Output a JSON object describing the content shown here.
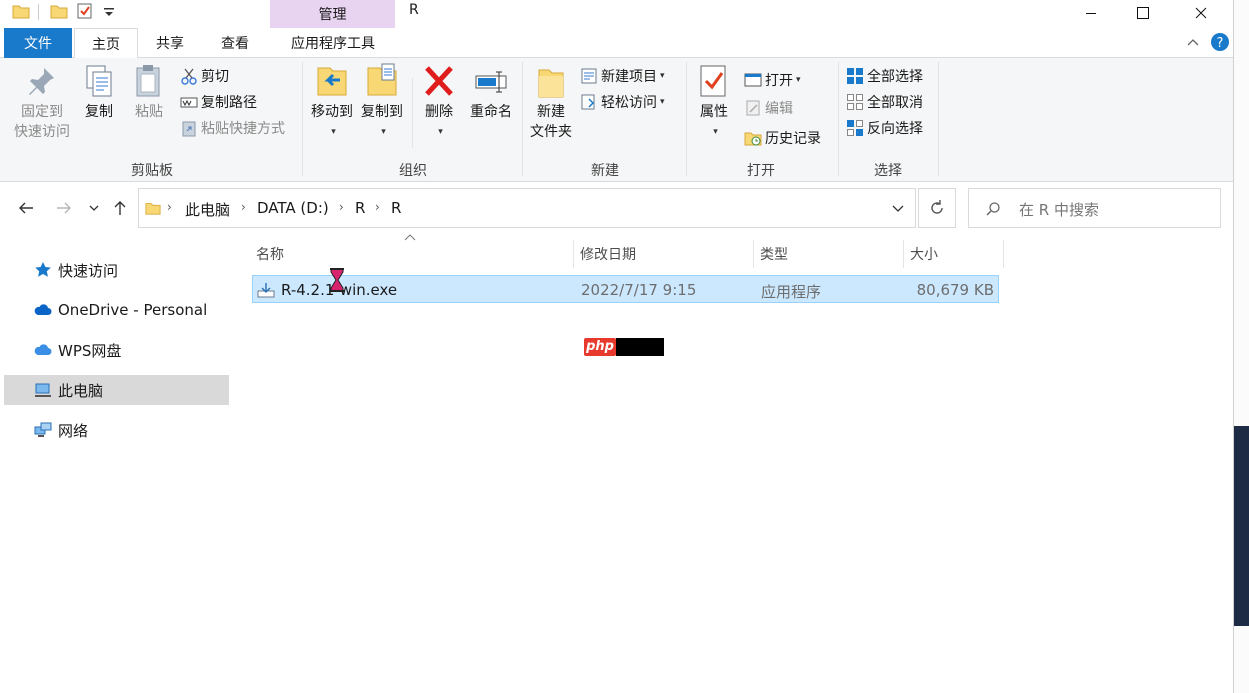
{
  "window": {
    "title": "R",
    "context_tab_group": "管理"
  },
  "tabs": [
    {
      "label": "文件"
    },
    {
      "label": "主页"
    },
    {
      "label": "共享"
    },
    {
      "label": "查看"
    },
    {
      "label": "应用程序工具"
    }
  ],
  "ribbon": {
    "clipboard": {
      "group_label": "剪贴板",
      "pin_line1": "固定到",
      "pin_line2": "快速访问",
      "copy": "复制",
      "paste": "粘贴",
      "cut": "剪切",
      "copy_path": "复制路径",
      "paste_shortcut": "粘贴快捷方式"
    },
    "organize": {
      "group_label": "组织",
      "move_to": "移动到",
      "copy_to": "复制到",
      "delete": "删除",
      "rename": "重命名"
    },
    "new": {
      "group_label": "新建",
      "new_folder_line1": "新建",
      "new_folder_line2": "文件夹",
      "new_item": "新建项目",
      "easy_access": "轻松访问"
    },
    "open": {
      "group_label": "打开",
      "properties": "属性",
      "open": "打开",
      "edit": "编辑",
      "history": "历史记录"
    },
    "select": {
      "group_label": "选择",
      "select_all": "全部选择",
      "select_none": "全部取消",
      "invert": "反向选择"
    }
  },
  "address": {
    "crumbs": [
      "此电脑",
      "DATA (D:)",
      "R",
      "R"
    ],
    "search_placeholder": "在 R 中搜索"
  },
  "nav_pane": [
    {
      "label": "快速访问"
    },
    {
      "label": "OneDrive - Personal"
    },
    {
      "label": "WPS网盘"
    },
    {
      "label": "此电脑"
    },
    {
      "label": "网络"
    }
  ],
  "columns": {
    "name": "名称",
    "modified": "修改日期",
    "type": "类型",
    "size": "大小"
  },
  "files": [
    {
      "name": "R-4.2.1-win.exe",
      "modified": "2022/7/17 9:15",
      "type": "应用程序",
      "size": "80,679 KB"
    }
  ],
  "watermark": "php",
  "colors": {
    "file_tab": "#1979ca",
    "manage_band": "#e8d3f0",
    "selection": "#cce8ff",
    "selection_border": "#99d1ff"
  }
}
